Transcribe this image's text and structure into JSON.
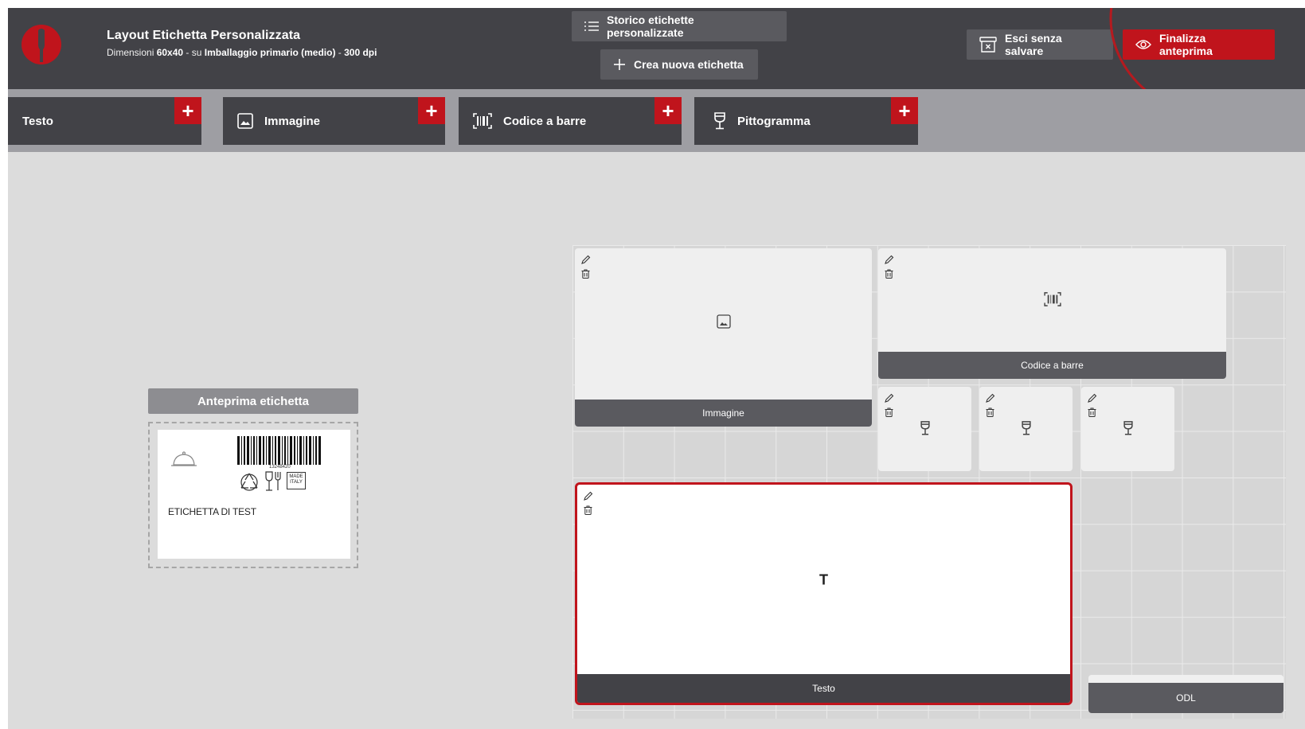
{
  "header": {
    "title": "Layout Etichetta Personalizzata",
    "subtitle_prefix": "Dimensioni ",
    "dimensions": "60x40",
    "subtitle_mid": " - su ",
    "packaging": "Imballaggio primario (medio)",
    "subtitle_sep": " - ",
    "dpi": "300 dpi",
    "history_label": "Storico etichette personalizzate",
    "new_label": "Crea nuova etichetta",
    "exit_label": "Esci senza salvare",
    "finalize_label": "Finalizza anteprima"
  },
  "toolbar": {
    "items": [
      {
        "label": "Testo",
        "icon": "none"
      },
      {
        "label": "Immagine",
        "icon": "image-icon"
      },
      {
        "label": "Codice a barre",
        "icon": "barcode-icon"
      },
      {
        "label": "Pittogramma",
        "icon": "wine-glass-icon"
      }
    ],
    "add_symbol": "+"
  },
  "preview": {
    "heading": "Anteprima etichetta",
    "barcode_number": "13248420",
    "made_in_italy_line1": "MADE",
    "made_in_italy_line2": "ITALY",
    "text": "ETICHETTA DI TEST"
  },
  "canvas": {
    "blocks": [
      {
        "type": "image",
        "caption": "Immagine"
      },
      {
        "type": "barcode",
        "caption": "Codice a barre"
      },
      {
        "type": "pictogram",
        "caption": ""
      },
      {
        "type": "pictogram",
        "caption": ""
      },
      {
        "type": "pictogram",
        "caption": ""
      },
      {
        "type": "text",
        "caption": "Testo",
        "glyph": "T",
        "selected": true
      },
      {
        "type": "odl",
        "caption": "ODL"
      }
    ]
  },
  "colors": {
    "accent": "#c0141c",
    "header_bg": "#424247",
    "toolbar_bg": "#9e9ea3",
    "workspace_bg": "#dcdcdc"
  }
}
